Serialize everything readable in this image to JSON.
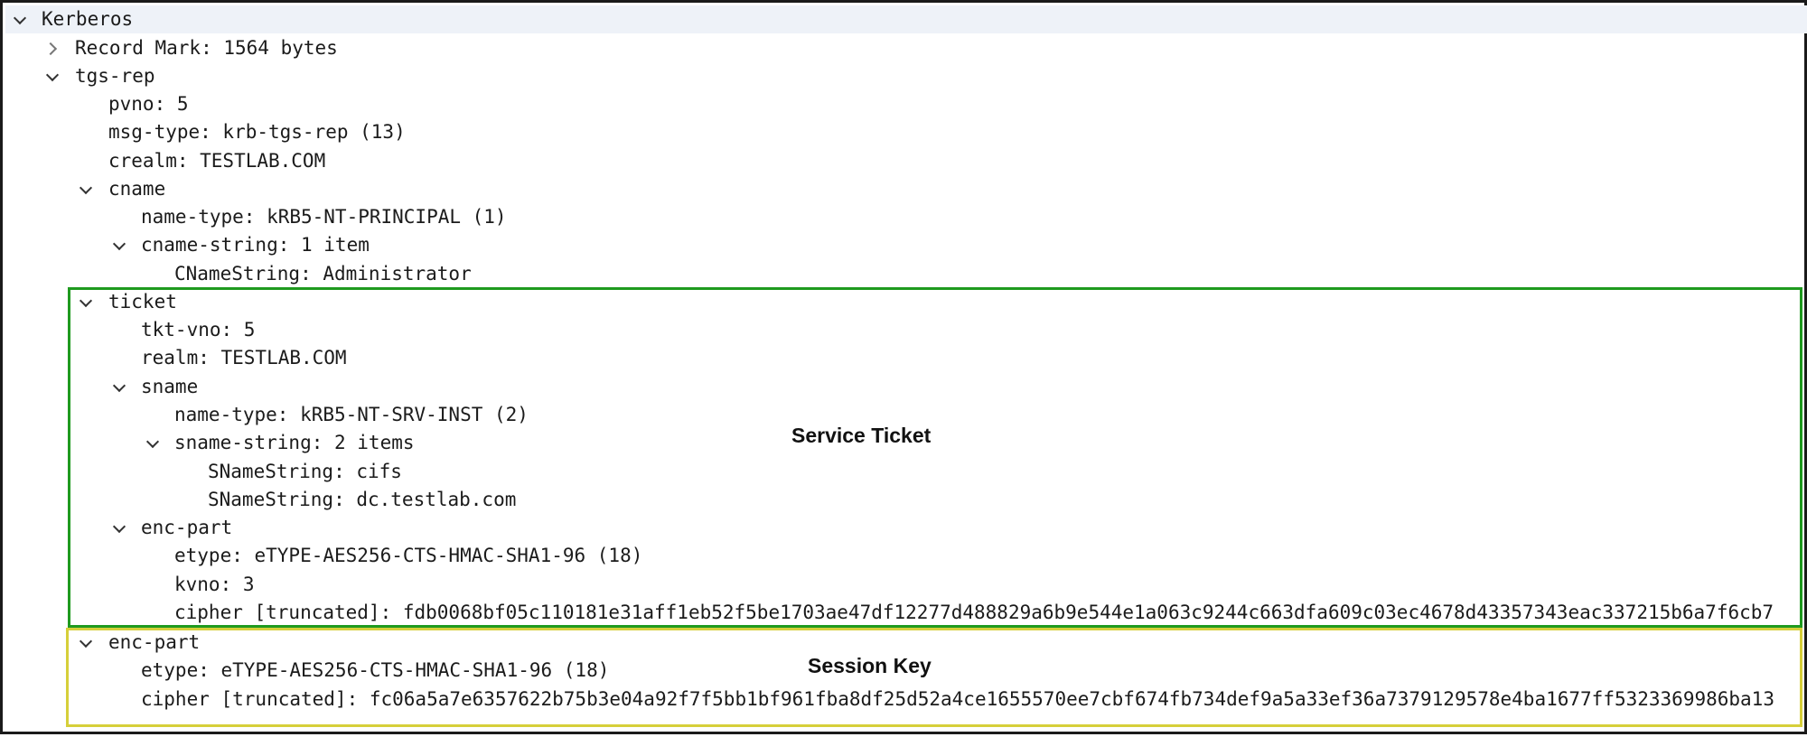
{
  "tree": {
    "kerberos": "Kerberos",
    "record_mark": "Record Mark: 1564 bytes",
    "tgs_rep": "tgs-rep",
    "pvno": "pvno: 5",
    "msg_type": "msg-type: krb-tgs-rep (13)",
    "crealm": "crealm: TESTLAB.COM",
    "cname": "cname",
    "cname_name_type": "name-type: kRB5-NT-PRINCIPAL (1)",
    "cname_string": "cname-string: 1 item",
    "cname_string_value": "CNameString: Administrator",
    "ticket": "ticket",
    "tkt_vno": "tkt-vno: 5",
    "realm": "realm: TESTLAB.COM",
    "sname": "sname",
    "sname_name_type": "name-type: kRB5-NT-SRV-INST (2)",
    "sname_string": "sname-string: 2 items",
    "sname_string_1": "SNameString: cifs",
    "sname_string_2": "SNameString: dc.testlab.com",
    "ticket_enc_part": "enc-part",
    "ticket_etype": "etype: eTYPE-AES256-CTS-HMAC-SHA1-96 (18)",
    "ticket_kvno": "kvno: 3",
    "ticket_cipher": "cipher [truncated]: fdb0068bf05c110181e31aff1eb52f5be1703ae47df12277d488829a6b9e544e1a063c9244c663dfa609c03ec4678d43357343eac337215b6a7f6cb7",
    "enc_part": "enc-part",
    "enc_part_etype": "etype: eTYPE-AES256-CTS-HMAC-SHA1-96 (18)",
    "enc_part_cipher": "cipher [truncated]: fc06a5a7e6357622b75b3e04a92f7f5bb1bf961fba8df25d52a4ce1655570ee7cbf674fb734def9a5a33ef36a7379129578e4ba1677ff5323369986ba13"
  },
  "annotations": {
    "service_ticket": "Service Ticket",
    "session_key": "Session Key"
  },
  "colors": {
    "service_ticket_box": "#1f9a1f",
    "session_key_box": "#d6cf3a",
    "selected_row": "#eef2f8"
  }
}
